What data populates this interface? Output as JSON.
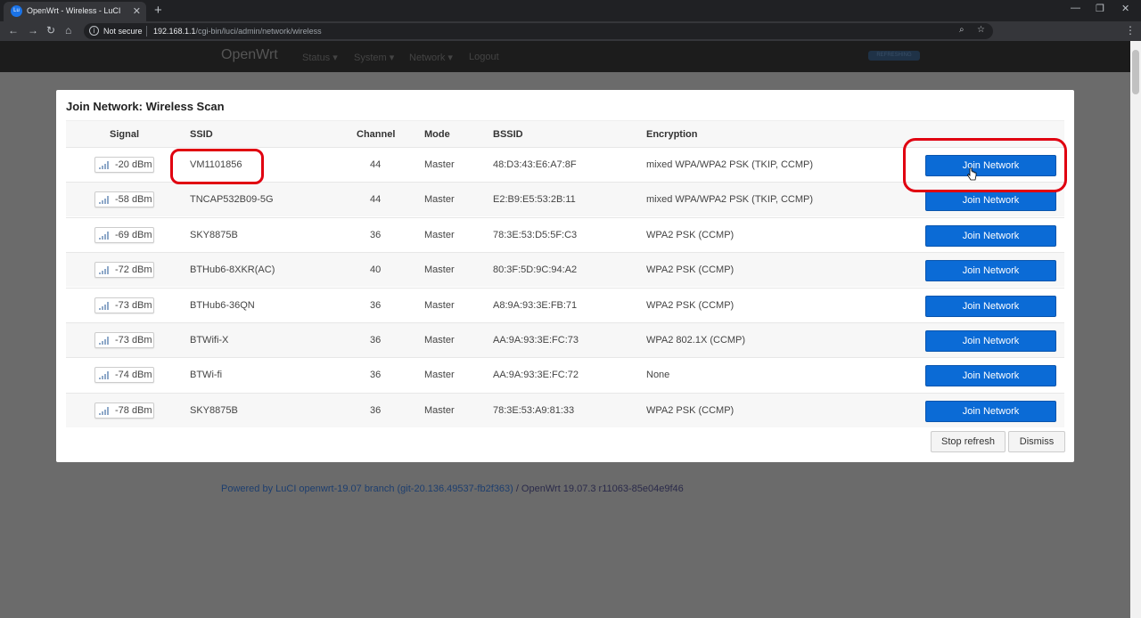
{
  "browser": {
    "tab_title": "OpenWrt - Wireless - LuCI",
    "tab_favicon": "Lu",
    "not_secure": "Not secure",
    "url_host": "192.168.1.1",
    "url_path": "/cgi-bin/luci/admin/network/wireless"
  },
  "header": {
    "brand": "OpenWrt",
    "menu": [
      "Status ▾",
      "System ▾",
      "Network ▾",
      "Logout"
    ],
    "refresh_badge": "REFRESHING"
  },
  "modal": {
    "title": "Join Network: Wireless Scan",
    "columns": [
      "Signal",
      "SSID",
      "Channel",
      "Mode",
      "BSSID",
      "Encryption"
    ],
    "rows": [
      {
        "signal": "-20 dBm",
        "ssid": "VM1101856",
        "channel": "44",
        "mode": "Master",
        "bssid": "48:D3:43:E6:A7:8F",
        "encryption": "mixed WPA/WPA2 PSK (TKIP, CCMP)",
        "action": "Join Network"
      },
      {
        "signal": "-58 dBm",
        "ssid": "TNCAP532B09-5G",
        "channel": "44",
        "mode": "Master",
        "bssid": "E2:B9:E5:53:2B:11",
        "encryption": "mixed WPA/WPA2 PSK (TKIP, CCMP)",
        "action": "Join Network"
      },
      {
        "signal": "-69 dBm",
        "ssid": "SKY8875B",
        "channel": "36",
        "mode": "Master",
        "bssid": "78:3E:53:D5:5F:C3",
        "encryption": "WPA2 PSK (CCMP)",
        "action": "Join Network"
      },
      {
        "signal": "-72 dBm",
        "ssid": "BTHub6-8XKR(AC)",
        "channel": "40",
        "mode": "Master",
        "bssid": "80:3F:5D:9C:94:A2",
        "encryption": "WPA2 PSK (CCMP)",
        "action": "Join Network"
      },
      {
        "signal": "-73 dBm",
        "ssid": "BTHub6-36QN",
        "channel": "36",
        "mode": "Master",
        "bssid": "A8:9A:93:3E:FB:71",
        "encryption": "WPA2 PSK (CCMP)",
        "action": "Join Network"
      },
      {
        "signal": "-73 dBm",
        "ssid": "BTWifi-X",
        "channel": "36",
        "mode": "Master",
        "bssid": "AA:9A:93:3E:FC:73",
        "encryption": "WPA2 802.1X (CCMP)",
        "action": "Join Network"
      },
      {
        "signal": "-74 dBm",
        "ssid": "BTWi-fi",
        "channel": "36",
        "mode": "Master",
        "bssid": "AA:9A:93:3E:FC:72",
        "encryption": "None",
        "action": "Join Network"
      },
      {
        "signal": "-78 dBm",
        "ssid": "SKY8875B",
        "channel": "36",
        "mode": "Master",
        "bssid": "78:3E:53:A9:81:33",
        "encryption": "WPA2 PSK (CCMP)",
        "action": "Join Network"
      }
    ],
    "stop_refresh": "Stop refresh",
    "dismiss": "Dismiss"
  },
  "footer": {
    "powered": "Powered by LuCI openwrt-19.07 branch (git-20.136.49537-fb2f363)",
    "version": " / OpenWrt 19.07.3 r11063-85e04e9f46"
  },
  "colors": {
    "join_button": "#0b6bd6",
    "highlight": "#e00010"
  }
}
